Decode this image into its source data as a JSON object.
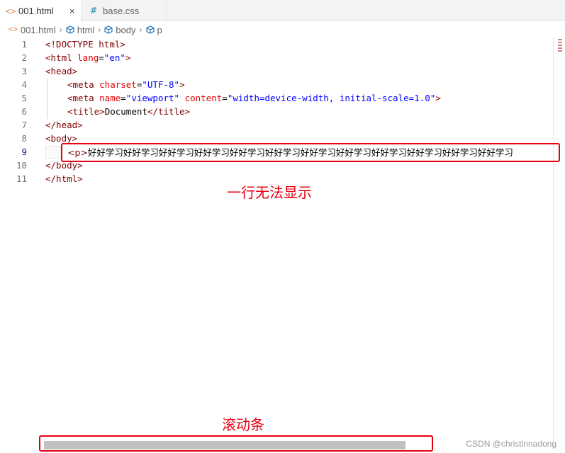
{
  "tabs": [
    {
      "label": "001.html",
      "icon": "html-icon",
      "active": true,
      "close": "×"
    },
    {
      "label": "base.css",
      "icon": "css-hash-icon",
      "active": false
    }
  ],
  "breadcrumb": {
    "file": "001.html",
    "items": [
      "html",
      "body",
      "p"
    ],
    "separator": "›"
  },
  "code_lines": [
    {
      "num": "1"
    },
    {
      "num": "2"
    },
    {
      "num": "3"
    },
    {
      "num": "4"
    },
    {
      "num": "5"
    },
    {
      "num": "6"
    },
    {
      "num": "7"
    },
    {
      "num": "8"
    },
    {
      "num": "9"
    },
    {
      "num": "10"
    },
    {
      "num": "11"
    }
  ],
  "code": {
    "l1_doctype": "<!DOCTYPE ",
    "l1_html": "html",
    "l1_close": ">",
    "l2_open": "<html ",
    "l2_attr": "lang",
    "l2_eq": "=",
    "l2_val": "\"en\"",
    "l2_close": ">",
    "l3": "<head>",
    "l4_open": "<meta ",
    "l4_attr": "charset",
    "l4_eq": "=",
    "l4_val": "\"UTF-8\"",
    "l4_close": ">",
    "l5_open": "<meta ",
    "l5_attr1": "name",
    "l5_eq1": "=",
    "l5_val1": "\"viewport\"",
    "l5_attr2": " content",
    "l5_eq2": "=",
    "l5_val2": "\"width=device-width, initial-scale=1.0\"",
    "l5_close": ">",
    "l6_open": "<title>",
    "l6_text": "Document",
    "l6_close": "</title>",
    "l7": "</head>",
    "l8": "<body>",
    "l9_open": "<p>",
    "l9_text": "好好学习好好学习好好学习好好学习好好学习好好学习好好学习好好学习好好学习好好学习好好学习好好学习",
    "l10": "</body>",
    "l11": "</html>"
  },
  "annotations": {
    "line_label": "一行无法显示",
    "scroll_label": "滚动条"
  },
  "watermark": "CSDN @christinnadong",
  "colors": {
    "tag": "#800000",
    "attribute": "#e50000",
    "string": "#0000ff",
    "annotation": "#e60012"
  }
}
